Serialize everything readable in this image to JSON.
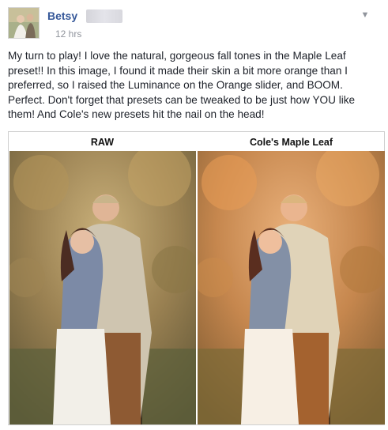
{
  "post": {
    "author_name": "Betsy",
    "timestamp": "12 hrs",
    "text": "My turn to play! I love the natural, gorgeous fall tones in the Maple Leaf preset!! In this image, I found it made their skin a bit more orange than I preferred, so I raised the Luminance on the Orange slider, and BOOM. Perfect. Don't forget that presets can be tweaked to be just how YOU like them! And Cole's new presets hit the nail on the head!"
  },
  "comparison": {
    "left_label": "RAW",
    "right_label": "Cole's Maple Leaf"
  },
  "icons": {
    "menu": "chevron-down-icon"
  }
}
